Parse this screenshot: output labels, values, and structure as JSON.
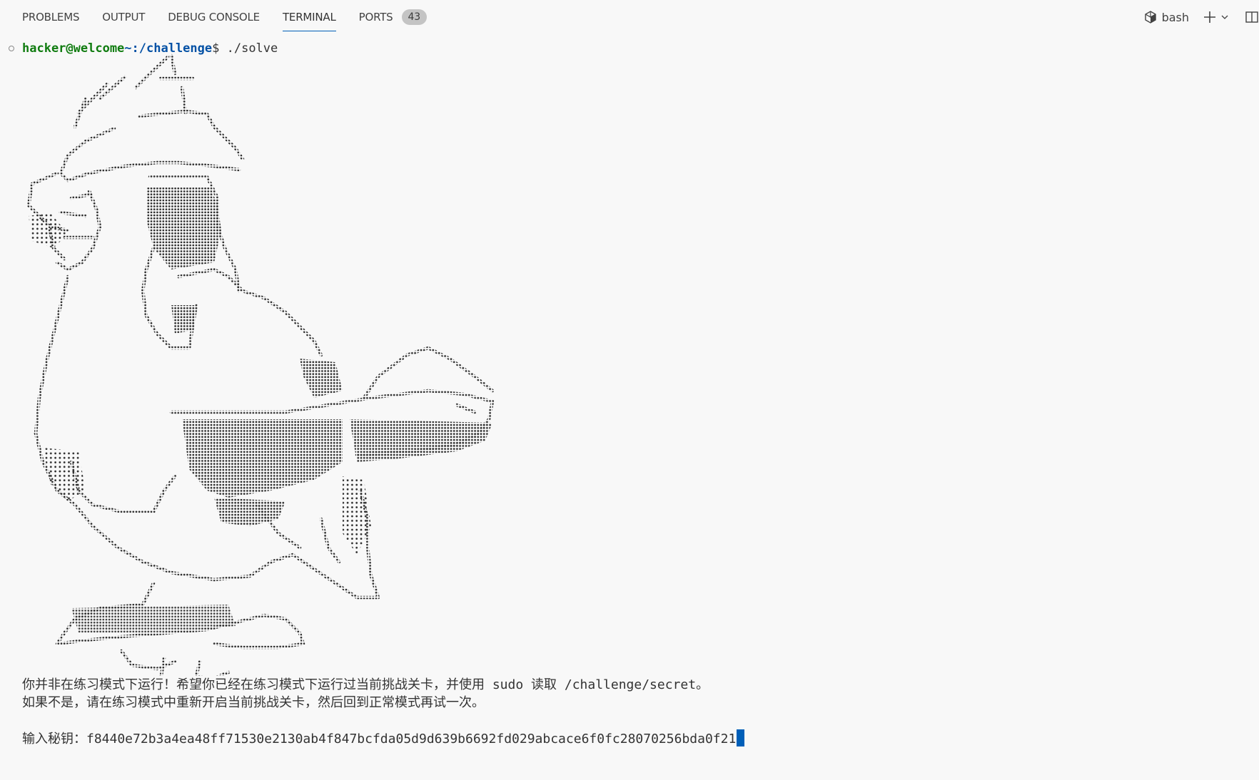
{
  "tabs": [
    {
      "label": "PROBLEMS"
    },
    {
      "label": "OUTPUT"
    },
    {
      "label": "DEBUG CONSOLE"
    },
    {
      "label": "TERMINAL"
    },
    {
      "label": "PORTS"
    }
  ],
  "ports_count": "43",
  "active_tab": "TERMINAL",
  "terminal_profile": "bash",
  "prompt": {
    "user_host": "hacker@welcome",
    "path": "~:/challenge",
    "symbol": "$",
    "command": " ./solve"
  },
  "messages": {
    "line1": "你并非在练习模式下运行！希望你已经在练习模式下运行过当前挑战关卡，并使用 sudo 读取 /challenge/secret。",
    "line2": "如果不是，请在练习模式中重新开启当前挑战关卡，然后回到正常模式再试一次。",
    "input_label": "输入秘钥：",
    "input_value": "f8440e72b3a4ea48ff71530e2130ab4f847bcfda05d9d639b6692fd029abcace6f0fc28070256bda0f21"
  },
  "icons": {
    "terminal": "terminal-profile-icon",
    "add": "plus-icon",
    "dropdown": "chevron-down-icon",
    "split": "split-editor-icon"
  },
  "colors": {
    "background": "#f8f8f8",
    "user": "#107c10",
    "path": "#0451a5",
    "cursor": "#005fb8",
    "badge": "#c4c4c4"
  }
}
